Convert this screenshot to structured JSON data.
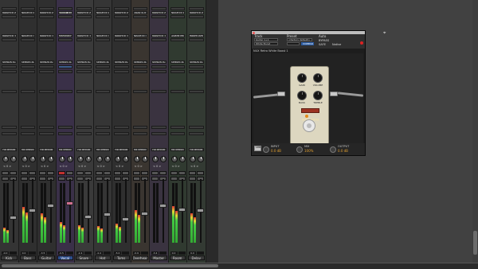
{
  "mixer": {
    "strips": [
      {
        "name": "Kick",
        "input": "NASHTE A-B",
        "output": "NASHTE T-B",
        "send": "SENDS A-E",
        "group": "no group",
        "pan": "< 0 >",
        "value": "-0.0",
        "meter": 0.25,
        "fader": 0.38,
        "selected": false,
        "highlight": false
      },
      {
        "name": "Bass",
        "input": "NASHTE A-B",
        "output": "NASHTE T-B",
        "send": "SENDS A-E",
        "group": "no group",
        "pan": "< 0 >",
        "value": "0.0",
        "meter": 0.6,
        "fader": 0.5,
        "selected": false,
        "highlight": false
      },
      {
        "name": "Guitar",
        "input": "NASHTE A-B",
        "output": "NASHTE T-B",
        "send": "SENDS A-E",
        "group": "no group",
        "pan": "< 0 >",
        "value": "-3.5",
        "meter": 0.5,
        "fader": 0.58,
        "selected": false,
        "highlight": false
      },
      {
        "name": "Vocal",
        "input": "White Boost",
        "output": "MarshallFx",
        "send": "SENDS A-E",
        "group": "no group",
        "pan": "< 0 >",
        "value": "-0.5",
        "meter": 0.35,
        "fader": 0.62,
        "selected": true,
        "highlight": true
      },
      {
        "name": "Snare",
        "input": "NASHTE A-B",
        "output": "NASHTE T-B",
        "send": "SENDS A-E",
        "group": "no group",
        "pan": "< 0 >",
        "value": "-2.4",
        "meter": 0.3,
        "fader": 0.4,
        "selected": false,
        "highlight": false
      },
      {
        "name": "Hat",
        "input": "NASHTE A-B",
        "output": "NASHTE T-B",
        "send": "SENDS A-E",
        "group": "no group",
        "pan": "< 0 >",
        "value": "-4.4",
        "meter": 0.28,
        "fader": 0.44,
        "selected": false,
        "highlight": false
      },
      {
        "name": "Toms",
        "input": "NASHTE A-B",
        "output": "NASHTE T-B",
        "send": "SENDS A-E",
        "group": "no group",
        "pan": "< 0 >",
        "value": "-5.0",
        "meter": 0.32,
        "fader": 0.36,
        "selected": false,
        "highlight": false
      },
      {
        "name": "Overheads",
        "input": "ADD 4-5",
        "output": "NASHTE T-B",
        "send": "SENDS A-E",
        "group": "no group",
        "pan": "< 0 >",
        "value": "-0.9",
        "meter": 0.55,
        "fader": 0.45,
        "selected": false,
        "highlight": false
      },
      {
        "name": "Master",
        "input": "NASHTE A-B",
        "output": "NASHTE T-B",
        "send": "SENDS A-E",
        "group": "no group",
        "pan": "< 0 >",
        "value": "-3.4",
        "meter": 0.0,
        "fader": 0.58,
        "selected": false,
        "highlight": false
      },
      {
        "name": "Room",
        "input": "NASHTE A-B",
        "output": "Guard Mic",
        "send": "SENDS A-E",
        "group": "no group",
        "pan": "< 0 >",
        "value": "0.0",
        "meter": 0.62,
        "fader": 0.52,
        "selected": false,
        "highlight": false
      },
      {
        "name": "Delay",
        "input": "NASHTE A-B",
        "output": "Room Amb",
        "send": "SENDS A-E",
        "group": "no group",
        "pan": "< 0 >",
        "value": "0.0",
        "meter": 0.5,
        "fader": 0.5,
        "selected": false,
        "highlight": false
      }
    ]
  },
  "plugin": {
    "track_label": "Track",
    "preset_label": "Preset",
    "auto_label": "Auto",
    "track_value": "Guitar 1+1",
    "insert_value": "White Boost",
    "preset_value": "<factory default>",
    "compare_label": "COMPARE",
    "bypass_label": "BYPASS",
    "safe_label": "SAFE",
    "native_label": "Native",
    "plugin_name": "NUX Retro White Boost 1",
    "pedal": {
      "knobs": [
        "GAIN",
        "VOLUME",
        "BASS",
        "TREBLE"
      ],
      "logo": "WHITE BOOST"
    },
    "footer": {
      "input_label": "INPUT",
      "input_value": "0.0 dB",
      "mix_label": "MIX",
      "mix_value": "100%",
      "output_label": "OUTPUT",
      "output_value": "0.0 dB",
      "badge": "LINE 6"
    }
  },
  "colors": {
    "accent": "#e2a030",
    "selected": "#2d4d8c",
    "record": "#c23030"
  }
}
